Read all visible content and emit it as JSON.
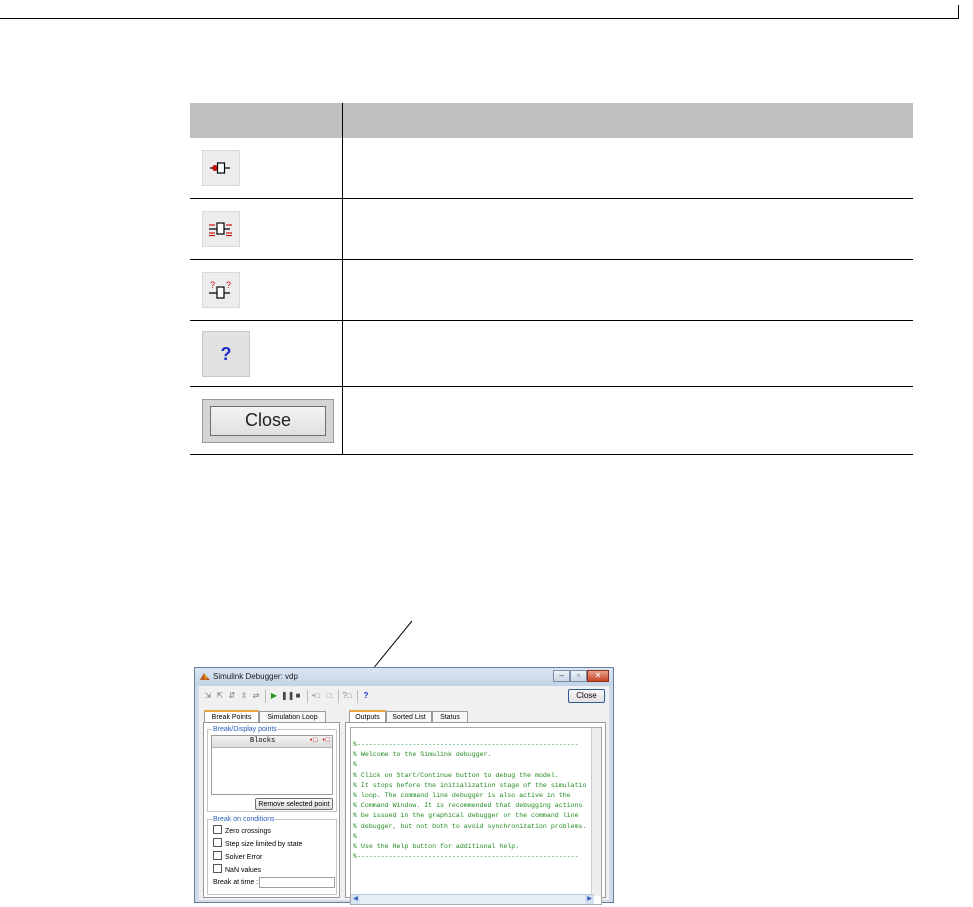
{
  "table": {
    "header": {
      "col1": "",
      "col2": ""
    },
    "rows": [
      {
        "icon": "breakpoint-before-block-icon",
        "description": ""
      },
      {
        "icon": "display-io-block-icon",
        "description": ""
      },
      {
        "icon": "watch-io-block-icon",
        "description": ""
      },
      {
        "icon": "help-icon",
        "icon_text": "?",
        "description": ""
      },
      {
        "icon": "close-button-image",
        "button_label": "Close",
        "description": ""
      }
    ]
  },
  "debugger": {
    "window_title": "Simulink Debugger: vdp",
    "close_label": "Close",
    "help_glyph": "?",
    "left_tabs": [
      "Break Points",
      "Simulation Loop"
    ],
    "right_tabs": [
      "Outputs",
      "Sorted List",
      "Status"
    ],
    "break_display_group": "Break/Display points",
    "blocks_header": "Blocks",
    "remove_button": "Remove selected point",
    "break_conditions_group": "Break on conditions",
    "conditions": [
      "Zero crossings",
      "Step size limited by state",
      "Solver Error",
      "NaN values"
    ],
    "break_at_time_label": "Break at time :",
    "break_at_time_value": "",
    "output_lines": [
      "%--------------------------------------------------------",
      "% Welcome to the Simulink debugger.",
      "%",
      "% Click on Start/Continue button to debug the model.",
      "% It stops before the initialization stage of the simulatio",
      "% loop. The command line debugger is also active in the",
      "% Command Window. It is recommended that debugging actions",
      "% be issued in the graphical debugger or the command line",
      "% debugger, but not both to avoid synchronization problems.",
      "%",
      "% Use the Help button for additional help.",
      "%--------------------------------------------------------"
    ],
    "output_text_color": "#1f8a1f",
    "accent_color": "#e9a640",
    "group_label_color": "#2a5dbb"
  }
}
